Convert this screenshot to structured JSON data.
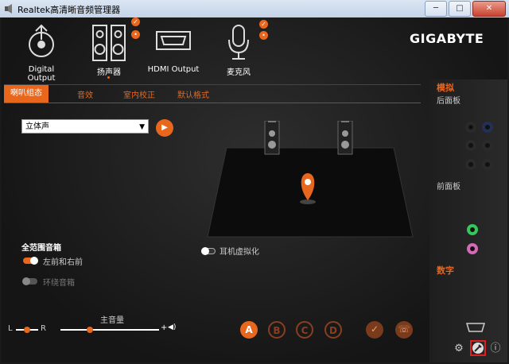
{
  "window": {
    "title": "Realtek高清晰音频管理器",
    "minimize_glyph": "─",
    "maximize_glyph": "□",
    "close_glyph": "✕"
  },
  "brand": "GIGABYTE",
  "device_tabs": [
    {
      "label": "Digital Output",
      "icon": "digital-output-icon"
    },
    {
      "label": "扬声器",
      "icon": "speaker-icon"
    },
    {
      "label": "HDMI Output",
      "icon": "hdmi-icon"
    },
    {
      "label": "麦克风",
      "icon": "microphone-icon"
    }
  ],
  "badges": {
    "check": "✓",
    "dot": "•"
  },
  "sub_tabs": [
    "喇叭组态",
    "音效",
    "室内校正",
    "默认格式"
  ],
  "config": {
    "select_value": "立体声",
    "play_glyph": "▶",
    "full_range_title": "全范围音箱",
    "front_lr": "左前和右前",
    "surround": "环绕音箱",
    "headphone_virtualization": "耳机虚拟化"
  },
  "volume": {
    "title": "主音量",
    "left": "L",
    "right": "R",
    "plus": "+",
    "speaker_glyph": "◀)",
    "balance_fraction": 0.5,
    "level_fraction": 0.3
  },
  "profiles": [
    "A",
    "B",
    "C",
    "D"
  ],
  "profile_actions": {
    "confirm": "✓",
    "phone": "☏"
  },
  "side_panel": {
    "analog": "模拟",
    "back_panel": "后面板",
    "front_panel": "前面板",
    "digital": "数字"
  },
  "bottom_icons": {
    "settings": "⚙",
    "info": "ⓘ"
  },
  "colors": {
    "accent": "#e8671d",
    "jack_green": "#34c759",
    "jack_pink": "#d46ab5"
  }
}
